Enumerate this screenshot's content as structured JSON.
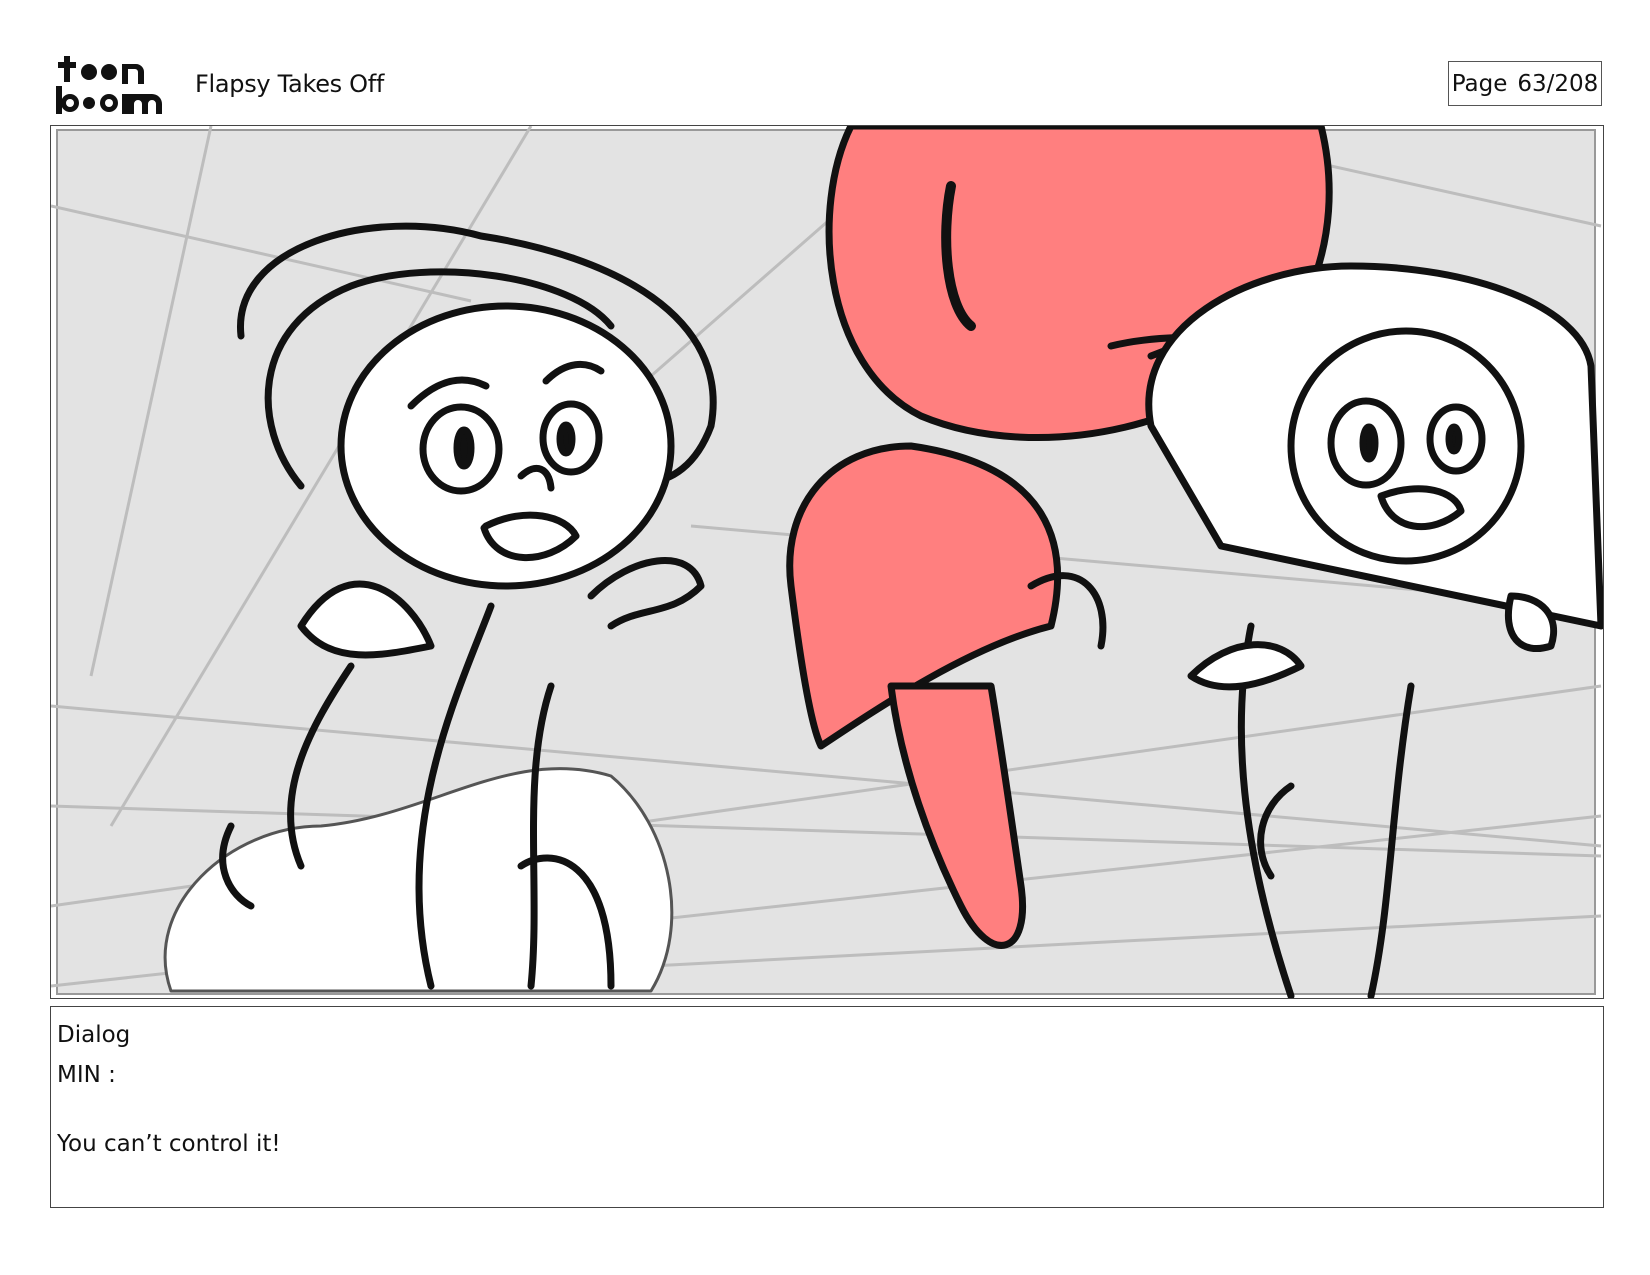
{
  "header": {
    "logo_text_top": "toon",
    "logo_text_bottom": "boom",
    "project_title": "Flapsy Takes Off",
    "page_label": "Page",
    "page_number": "63/208"
  },
  "panel": {
    "background_color": "#e3e3e3",
    "accent_color": "#ff7f7f",
    "line_color": "#000000"
  },
  "dialog": {
    "heading": "Dialog",
    "speaker": "MIN :",
    "line": "You can’t control it!"
  }
}
